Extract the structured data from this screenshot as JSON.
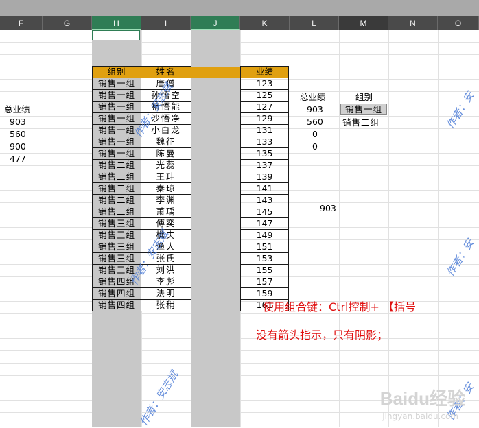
{
  "columns": [
    "F",
    "G",
    "H",
    "I",
    "J",
    "K",
    "L",
    "M",
    "N",
    "O"
  ],
  "selected_columns": [
    "H",
    "J",
    "M"
  ],
  "table": {
    "headers": [
      "组别",
      "姓名",
      "业绩"
    ],
    "rows": [
      {
        "group": "销售一组",
        "name": "唐僧",
        "score": "123"
      },
      {
        "group": "销售一组",
        "name": "孙悟空",
        "score": "125"
      },
      {
        "group": "销售一组",
        "name": "猪悟能",
        "score": "127"
      },
      {
        "group": "销售一组",
        "name": "沙悟净",
        "score": "129"
      },
      {
        "group": "销售一组",
        "name": "小白龙",
        "score": "131"
      },
      {
        "group": "销售一组",
        "name": "魏征",
        "score": "133"
      },
      {
        "group": "销售一组",
        "name": "陈曼",
        "score": "135"
      },
      {
        "group": "销售二组",
        "name": "光蕊",
        "score": "137"
      },
      {
        "group": "销售二组",
        "name": "王珪",
        "score": "139"
      },
      {
        "group": "销售二组",
        "name": "秦琼",
        "score": "141"
      },
      {
        "group": "销售二组",
        "name": "李渊",
        "score": "143"
      },
      {
        "group": "销售二组",
        "name": "萧瑀",
        "score": "145"
      },
      {
        "group": "销售三组",
        "name": "傅奕",
        "score": "147"
      },
      {
        "group": "销售三组",
        "name": "樵夫",
        "score": "149"
      },
      {
        "group": "销售三组",
        "name": "渔人",
        "score": "151"
      },
      {
        "group": "销售三组",
        "name": "张氏",
        "score": "153"
      },
      {
        "group": "销售三组",
        "name": "刘洪",
        "score": "155"
      },
      {
        "group": "销售四组",
        "name": "李彪",
        "score": "157"
      },
      {
        "group": "销售四组",
        "name": "法明",
        "score": "159"
      },
      {
        "group": "销售四组",
        "name": "张稍",
        "score": "161"
      }
    ]
  },
  "left_block": {
    "header": "总业绩",
    "values": [
      "903",
      "560",
      "900",
      "477"
    ]
  },
  "right_block": {
    "total_header": "总业绩",
    "group_header": "组别",
    "totals": [
      "903",
      "560",
      "0",
      "0"
    ],
    "groups": [
      "销售一组",
      "销售二组"
    ],
    "extra_value": "903"
  },
  "notes": {
    "line1": "使用组合键：Ctrl控制+ 【括号",
    "line2": "没有箭头指示，只有阴影；"
  },
  "watermarks": {
    "author": "作者：安志斌",
    "author_partial": "作者：安"
  },
  "logo": {
    "text": "Baidu经验",
    "sub": "jingyan.baidu.com"
  },
  "colors": {
    "header_fill": "#e0a010",
    "grouped_column_shade": "#c8c8c8",
    "selected_column_header": "#2f7d55",
    "note_text": "#e01010",
    "watermark_text": "#4b7bd6"
  }
}
